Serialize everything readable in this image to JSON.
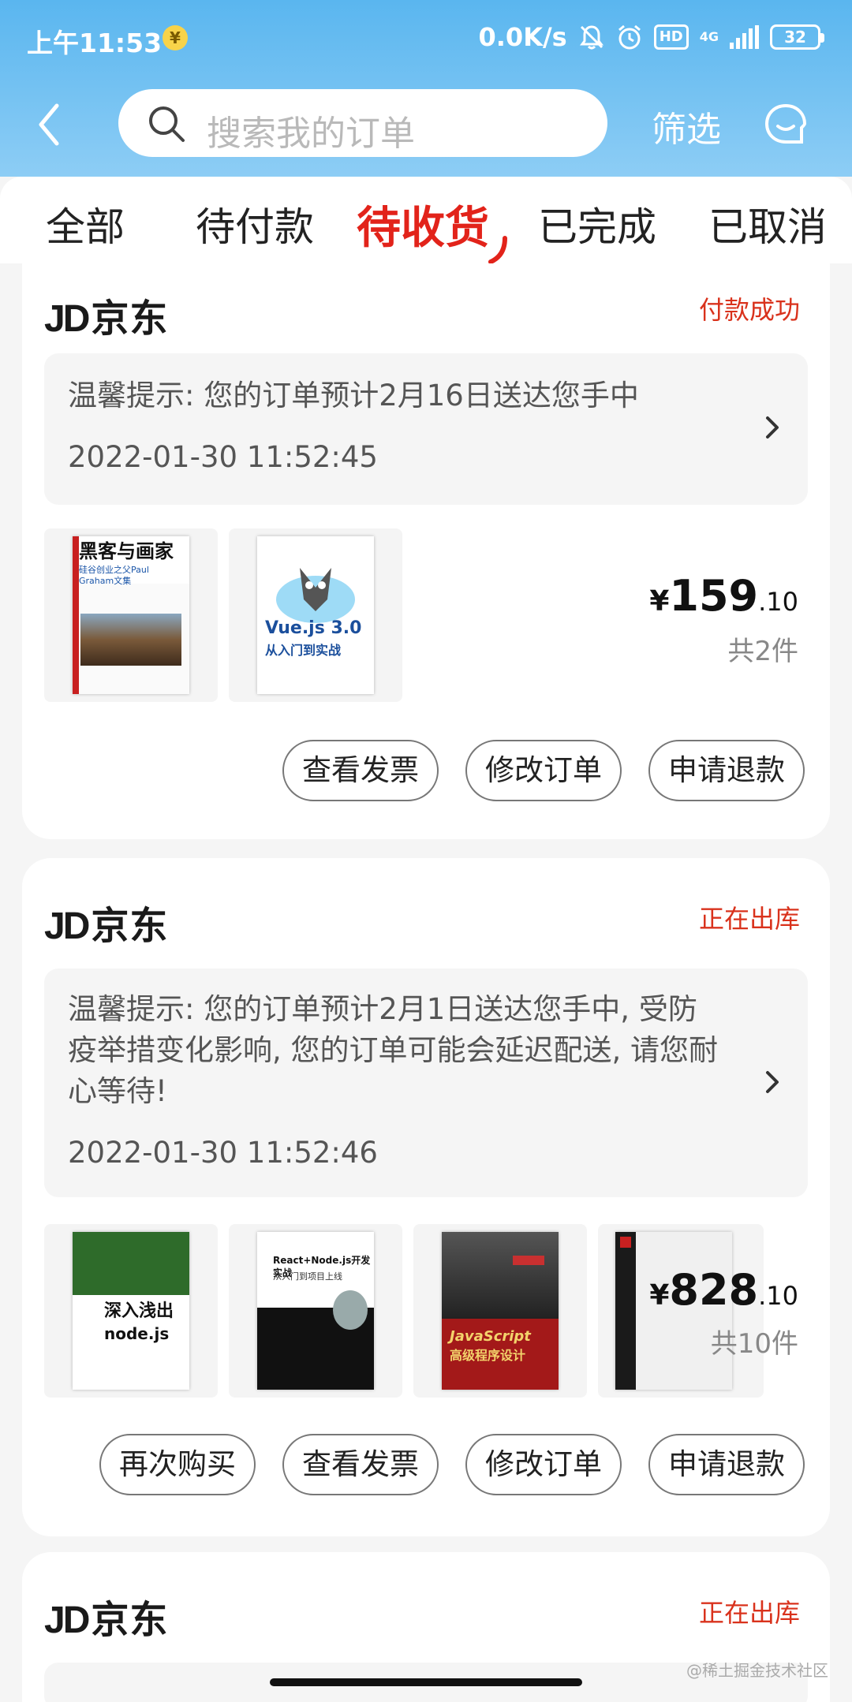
{
  "status_bar": {
    "time": "上午11:53",
    "yuan_badge": "¥",
    "net_speed": "0.0K/s",
    "hd": "HD",
    "net_type": "4G",
    "battery": "32"
  },
  "header": {
    "search_placeholder": "搜索我的订单",
    "filter_label": "筛选"
  },
  "tabs": [
    {
      "label": "全部"
    },
    {
      "label": "待付款"
    },
    {
      "label": "待收货",
      "active": true
    },
    {
      "label": "已完成"
    },
    {
      "label": "已取消"
    }
  ],
  "orders": [
    {
      "store": "JD",
      "store_suffix": "京东",
      "status": "付款成功",
      "tip": "温馨提示: 您的订单预计2月16日送达您手中",
      "time": "2022-01-30 11:52:45",
      "books": [
        {
          "title": "黑客与画家",
          "subtitle": "硅谷创业之父Paul Graham文集"
        },
        {
          "title": "Vue.js 3.0",
          "subtitle": "从入门到实战"
        }
      ],
      "price_symbol": "¥",
      "price_int": "159",
      "price_dec": ".10",
      "count": "共2件",
      "buttons": [
        "查看发票",
        "修改订单",
        "申请退款"
      ]
    },
    {
      "store": "JD",
      "store_suffix": "京东",
      "status": "正在出库",
      "tip": "温馨提示: 您的订单预计2月1日送达您手中, 受防疫举措变化影响, 您的订单可能会延迟配送, 请您耐心等待!",
      "time": "2022-01-30 11:52:46",
      "books": [
        {
          "title": "深入浅出",
          "subtitle": "node.js"
        },
        {
          "title": "React+Node.js开发实战",
          "subtitle": "从入门到项目上线"
        },
        {
          "title": "JavaScript",
          "subtitle": "高级程序设计"
        },
        {
          "title": "",
          "subtitle": ""
        }
      ],
      "price_symbol": "¥",
      "price_int": "828",
      "price_dec": ".10",
      "count": "共10件",
      "buttons": [
        "再次购买",
        "查看发票",
        "修改订单",
        "申请退款"
      ]
    },
    {
      "store": "JD",
      "store_suffix": "京东",
      "status": "正在出库"
    }
  ],
  "watermark": "@稀土掘金技术社区",
  "colors": {
    "accent_red": "#e2231a",
    "header_blue": "#5ab6ef"
  }
}
